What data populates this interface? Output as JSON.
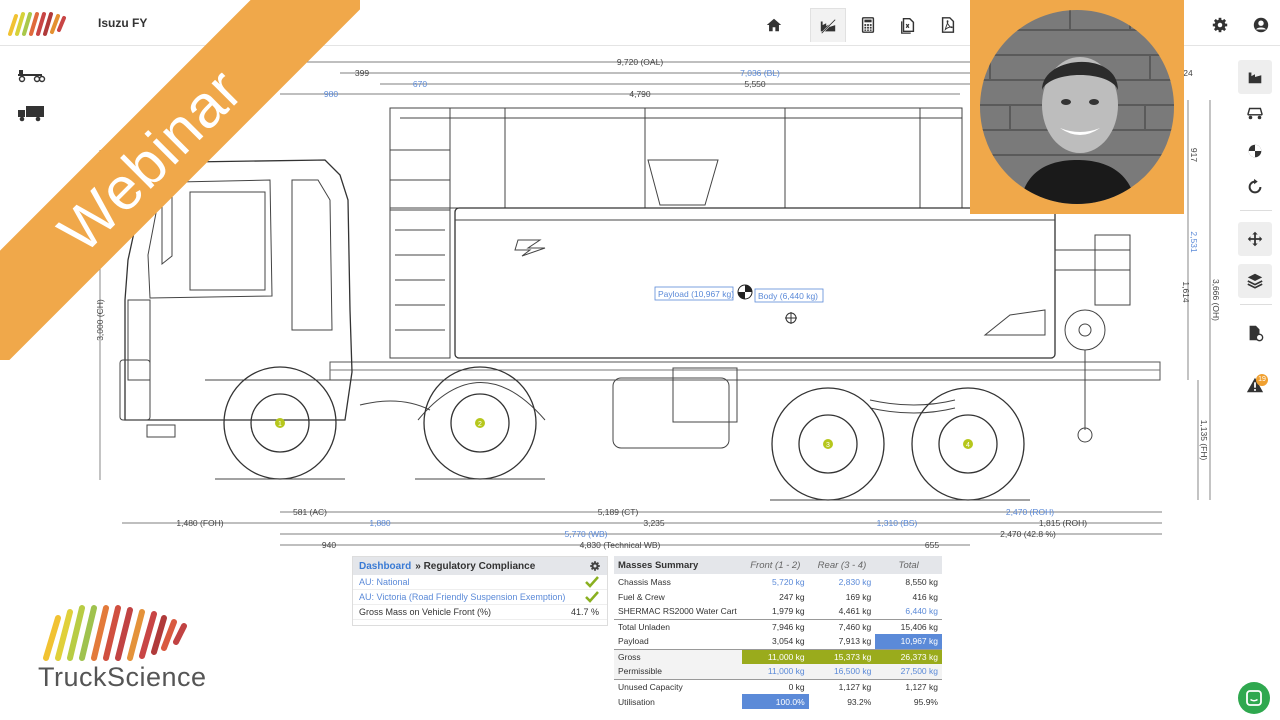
{
  "header": {
    "title": "Isuzu FY",
    "logo_icon": "truckscience-stripes-logo"
  },
  "nav": [
    {
      "icon": "home-icon"
    },
    {
      "icon": "truck-configuration-icon",
      "active": true
    },
    {
      "icon": "calculator-icon"
    },
    {
      "icon": "documents-icon"
    },
    {
      "icon": "pdf-icon"
    },
    {
      "icon": "settings-icon"
    },
    {
      "icon": "user-icon"
    }
  ],
  "banner": {
    "text": "Webinar",
    "color": "#f0a84a"
  },
  "drawing": {
    "top_dims": {
      "oal": "9,720 (OAL)",
      "dim399": "399",
      "dim670": "670",
      "bl": "7,036 (BL)",
      "dim5550": "5,550",
      "dim980": "980",
      "dim4790": "4,790",
      "dim24": "24"
    },
    "side_dims": {
      "ch": "3,000 (CH)",
      "d917": "917",
      "d2531": "2,531",
      "d1614": "1,614",
      "oh": "3,666 (OH)",
      "fh": "1,135 (FH)"
    },
    "bottom_dims": {
      "ac": "581 (AC)",
      "ct": "5,189 (CT)",
      "roh": "2,470 (ROH)",
      "foh": "1,480 (FOH)",
      "d1880": "1,880",
      "d3235": "3,235",
      "bs": "1,310 (BS)",
      "roh2": "1,815 (ROH)",
      "wb": "5,770 (WB)",
      "d2470": "2,470 (42.8 %)",
      "d940": "940",
      "twb": "4,830 (Technical WB)",
      "d655": "655"
    },
    "labels": {
      "payload": "Payload (10,967 kg)",
      "body": "Body (6,440 kg)"
    },
    "axles": [
      "1",
      "2",
      "3",
      "4"
    ]
  },
  "compliance": {
    "crumb": "Dashboard",
    "title": "» Regulatory Compliance",
    "rows": [
      {
        "label": "AU: National",
        "check": true
      },
      {
        "label": "AU: Victoria (Road Friendly Suspension Exemption)",
        "check": true
      },
      {
        "label": "Gross Mass on Vehicle Front (%)",
        "value": "41.7 %"
      }
    ]
  },
  "masses": {
    "title": "Masses Summary",
    "headers": [
      "Front (1 - 2)",
      "Rear (3 - 4)",
      "Total"
    ],
    "rows": [
      {
        "label": "Chassis Mass",
        "front": "5,720 kg",
        "rear": "2,830 kg",
        "total": "8,550 kg"
      },
      {
        "label": "Fuel & Crew",
        "front": "247 kg",
        "rear": "169 kg",
        "total": "416 kg"
      },
      {
        "label": "SHERMAC RS2000 Water Cart",
        "front": "1,979 kg",
        "rear": "4,461 kg",
        "total": "6,440 kg"
      },
      {
        "label": "Total Unladen",
        "front": "7,946 kg",
        "rear": "7,460 kg",
        "total": "15,406 kg"
      },
      {
        "label": "Payload",
        "front": "3,054 kg",
        "rear": "7,913 kg",
        "total": "10,967 kg"
      },
      {
        "label": "Gross",
        "front": "11,000 kg",
        "rear": "15,373 kg",
        "total": "26,373 kg"
      },
      {
        "label": "Permissible",
        "front": "11,000 kg",
        "rear": "16,500 kg",
        "total": "27,500 kg"
      },
      {
        "label": "Unused Capacity",
        "front": "0 kg",
        "rear": "1,127 kg",
        "total": "1,127 kg"
      },
      {
        "label": "Utilisation",
        "front": "100.0%",
        "rear": "93.2%",
        "total": "95.9%"
      }
    ]
  },
  "right_toolbar": [
    {
      "icon": "body-config-icon",
      "active": true
    },
    {
      "icon": "axle-icon"
    },
    {
      "icon": "centre-of-gravity-icon"
    },
    {
      "icon": "rotate-icon"
    },
    {
      "icon": "move-icon",
      "active": true
    },
    {
      "icon": "layers-icon",
      "active": true
    },
    {
      "icon": "document-settings-icon"
    },
    {
      "icon": "warning-icon",
      "badge": "19"
    }
  ],
  "logo": {
    "text": "TruckScience"
  },
  "colors": {
    "accent_orange": "#f0a84a",
    "blue": "#5b8ad8",
    "green": "#9aab1c",
    "check_green": "#8ab020",
    "chat_green": "#2fa84f"
  }
}
